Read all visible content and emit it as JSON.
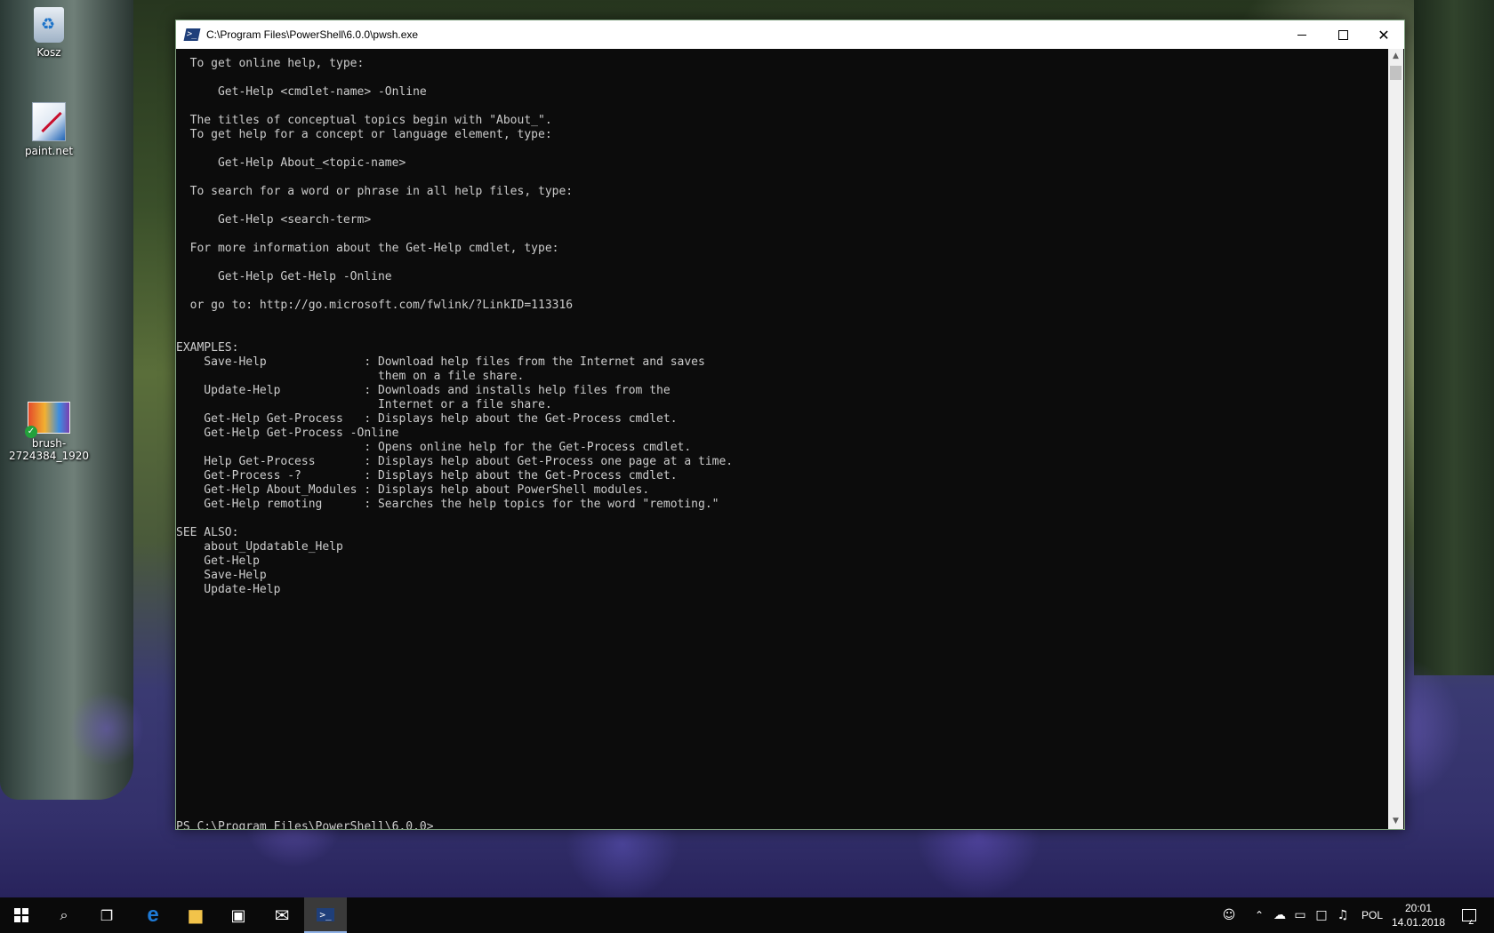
{
  "desktop": {
    "icons": [
      {
        "label": "Kosz",
        "icon": "recycle-bin-icon"
      },
      {
        "label": "paint.net",
        "icon": "paint-net-icon"
      },
      {
        "label": "brush-2724384_1920",
        "icon": "image-file-icon"
      }
    ]
  },
  "window": {
    "title": "C:\\Program Files\\PowerShell\\6.0.0\\pwsh.exe",
    "icon": "powershell-icon",
    "ps_glyph": ">_",
    "controls": {
      "minimize": "minimize-icon",
      "maximize": "maximize-icon",
      "close": "✕"
    }
  },
  "console": {
    "lines": [
      "  To get online help, type:",
      "",
      "      Get-Help <cmdlet-name> -Online",
      "",
      "  The titles of conceptual topics begin with \"About_\".",
      "  To get help for a concept or language element, type:",
      "",
      "      Get-Help About_<topic-name>",
      "",
      "  To search for a word or phrase in all help files, type:",
      "",
      "      Get-Help <search-term>",
      "",
      "  For more information about the Get-Help cmdlet, type:",
      "",
      "      Get-Help Get-Help -Online",
      "",
      "  or go to: http://go.microsoft.com/fwlink/?LinkID=113316",
      "",
      "",
      "EXAMPLES:",
      "    Save-Help              : Download help files from the Internet and saves",
      "                             them on a file share.",
      "    Update-Help            : Downloads and installs help files from the",
      "                             Internet or a file share.",
      "    Get-Help Get-Process   : Displays help about the Get-Process cmdlet.",
      "    Get-Help Get-Process -Online",
      "                           : Opens online help for the Get-Process cmdlet.",
      "    Help Get-Process       : Displays help about Get-Process one page at a time.",
      "    Get-Process -?         : Displays help about the Get-Process cmdlet.",
      "    Get-Help About_Modules : Displays help about PowerShell modules.",
      "    Get-Help remoting      : Searches the help topics for the word \"remoting.\"",
      "",
      "SEE ALSO:",
      "    about_Updatable_Help",
      "    Get-Help",
      "    Save-Help",
      "    Update-Help"
    ],
    "prompt": "PS C:\\Program Files\\PowerShell\\6.0.0>"
  },
  "scrollbar": {
    "up": "▲",
    "down": "▼"
  },
  "taskbar": {
    "items": [
      {
        "name": "start",
        "icon": "windows-logo-icon"
      },
      {
        "name": "search",
        "icon": "search-icon",
        "glyph": "⌕"
      },
      {
        "name": "task-view",
        "icon": "task-view-icon",
        "glyph": "❐"
      },
      {
        "name": "edge",
        "icon": "edge-icon",
        "glyph": "e"
      },
      {
        "name": "file-explorer",
        "icon": "folder-icon",
        "glyph": "■"
      },
      {
        "name": "store",
        "icon": "store-icon",
        "glyph": "▣"
      },
      {
        "name": "mail",
        "icon": "mail-icon",
        "glyph": "✉"
      },
      {
        "name": "powershell",
        "icon": "powershell-icon",
        "glyph": ">_"
      }
    ],
    "tray": {
      "people": "☺",
      "chevron": "⌃",
      "cloud": "☁",
      "battery": "▭",
      "network": "□",
      "volume": "♫",
      "language": "POL",
      "time": "20:01",
      "date": "14.01.2018"
    }
  },
  "colors": {
    "console_bg": "#0c0c0c",
    "console_fg": "#cccccc",
    "taskbar_bg": "#0a0a0a",
    "edge_blue": "#1e7ad6",
    "folder_yellow": "#f2c34a"
  }
}
